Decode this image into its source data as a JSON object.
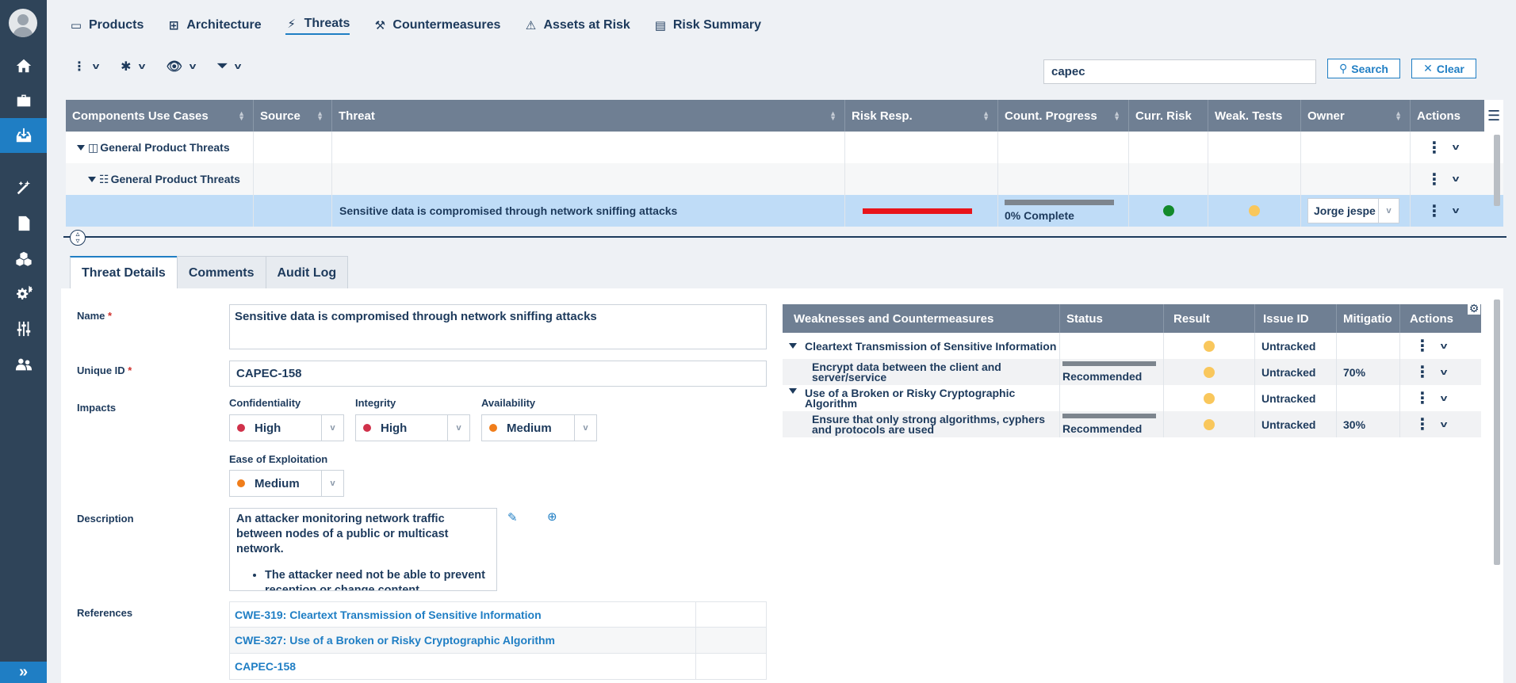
{
  "nav_tabs": [
    {
      "label": "Products",
      "icon": "laptop-icon"
    },
    {
      "label": "Architecture",
      "icon": "hierarchy-icon"
    },
    {
      "label": "Threats",
      "icon": "lightning-icon"
    },
    {
      "label": "Countermeasures",
      "icon": "hammer-icon"
    },
    {
      "label": "Assets at Risk",
      "icon": "warning-icon"
    },
    {
      "label": "Risk Summary",
      "icon": "table-icon"
    }
  ],
  "active_tab": "Threats",
  "search": {
    "value": "capec",
    "search_label": "Search",
    "clear_label": "Clear"
  },
  "grid": {
    "columns": [
      "Components Use Cases",
      "Source",
      "Threat",
      "Risk Resp.",
      "Count. Progress",
      "Curr. Risk",
      "Weak. Tests",
      "Owner",
      "Actions"
    ],
    "rows": [
      {
        "component": "General Product Threats",
        "level": 0
      },
      {
        "component": "General Product Threats",
        "level": 1
      },
      {
        "threat": "Sensitive data is compromised through network sniffing attacks",
        "risk_resp_fraction": 1.0,
        "risk_resp_color": "#e8141b",
        "progress_label": "0% Complete",
        "progress_fraction": 0.0,
        "curr_risk_color": "#138a2b",
        "weak_tests_color": "#f9c75c",
        "owner": "Jorge jespe"
      }
    ]
  },
  "detail_tabs": [
    "Threat Details",
    "Comments",
    "Audit Log"
  ],
  "details": {
    "name_label": "Name",
    "name_value": "Sensitive data is compromised through network sniffing attacks",
    "uid_label": "Unique ID",
    "uid_value": "CAPEC-158",
    "impacts_label": "Impacts",
    "confidentiality_label": "Confidentiality",
    "confidentiality_value": "High",
    "integrity_label": "Integrity",
    "integrity_value": "High",
    "availability_label": "Availability",
    "availability_value": "Medium",
    "ease_label": "Ease of Exploitation",
    "ease_value": "Medium",
    "description_label": "Description",
    "description_text": "An attacker monitoring network traffic between nodes of a public or multicast network.",
    "description_bullet": "The attacker need not be able to prevent reception or change content",
    "references_label": "References",
    "references": [
      "CWE-319: Cleartext Transmission of Sensitive Information",
      "CWE-327: Use of a Broken or Risky Cryptographic Algorithm",
      "CAPEC-158"
    ],
    "high_color": "#d0314a",
    "medium_color": "#f07d1a"
  },
  "weakness_grid": {
    "columns": [
      "Weaknesses and Countermeasures",
      "Status",
      "Result",
      "Issue ID",
      "Mitigatio",
      "Actions"
    ],
    "rows": [
      {
        "name": "Cleartext Transmission of Sensitive Information",
        "type": "weakness",
        "status": "",
        "result_color": "#f9c75c",
        "issue": "Untracked",
        "mitigation": ""
      },
      {
        "name": "Encrypt data between the client and server/service",
        "type": "countermeasure",
        "status": "Recommended",
        "result_color": "#f9c75c",
        "issue": "Untracked",
        "mitigation": "70%"
      },
      {
        "name": "Use of a Broken or Risky Cryptographic Algorithm",
        "type": "weakness",
        "status": "",
        "result_color": "#f9c75c",
        "issue": "Untracked",
        "mitigation": ""
      },
      {
        "name": "Ensure that only strong algorithms, cyphers and protocols are used",
        "type": "countermeasure",
        "status": "Recommended",
        "result_color": "#f9c75c",
        "issue": "Untracked",
        "mitigation": "30%"
      }
    ]
  }
}
